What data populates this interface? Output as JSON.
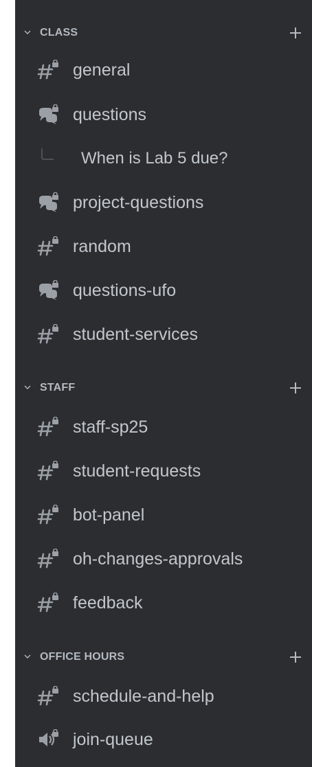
{
  "sidebar": {
    "categories": [
      {
        "label": "CLASS",
        "channels": [
          {
            "label": "general",
            "icon": "locked-text-channel-icon"
          },
          {
            "label": "questions",
            "icon": "locked-forum-channel-icon"
          },
          {
            "label": "When is Lab 5 due?",
            "icon": "thread-spine-icon",
            "kind": "thread"
          },
          {
            "label": "project-questions",
            "icon": "locked-forum-channel-icon"
          },
          {
            "label": "random",
            "icon": "locked-text-channel-icon"
          },
          {
            "label": "questions-ufo",
            "icon": "locked-forum-channel-icon"
          },
          {
            "label": "student-services",
            "icon": "locked-text-channel-icon"
          }
        ]
      },
      {
        "label": "STAFF",
        "channels": [
          {
            "label": "staff-sp25",
            "icon": "locked-text-channel-icon"
          },
          {
            "label": "student-requests",
            "icon": "locked-text-channel-icon"
          },
          {
            "label": "bot-panel",
            "icon": "locked-text-channel-icon"
          },
          {
            "label": "oh-changes-approvals",
            "icon": "locked-text-channel-icon"
          },
          {
            "label": "feedback",
            "icon": "locked-text-channel-icon"
          }
        ]
      },
      {
        "label": "OFFICE HOURS",
        "channels": [
          {
            "label": "schedule-and-help",
            "icon": "locked-text-channel-icon"
          },
          {
            "label": "join-queue",
            "icon": "locked-voice-channel-icon"
          }
        ]
      }
    ]
  },
  "colors": {
    "background": "#2b2d31",
    "text": "#c2c7cd",
    "category_text": "#b5bac1",
    "icon": "#9ba0a6"
  }
}
